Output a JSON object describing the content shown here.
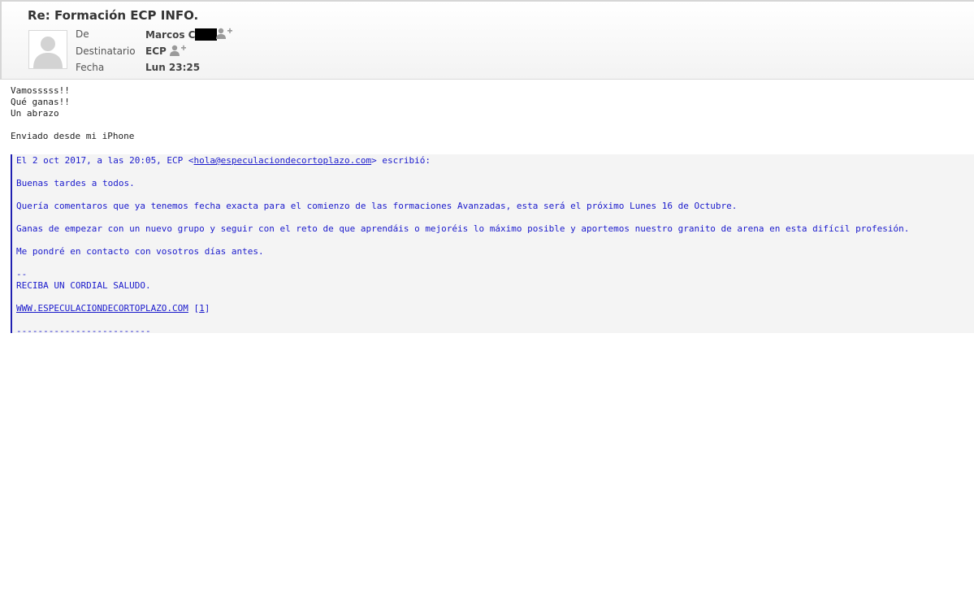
{
  "message": {
    "subject": "Re: Formación ECP INFO.",
    "from_label": "De",
    "from_value": "Marcos C",
    "to_label": "Destinatario",
    "to_value": "ECP",
    "date_label": "Fecha",
    "date_value": "Lun 23:25"
  },
  "body": {
    "line1": "Vamosssss!!",
    "line2": "Qué ganas!!",
    "line3": "Un abrazo",
    "signature": "Enviado desde mi iPhone"
  },
  "quote": {
    "intro_prefix": "El 2 oct 2017, a las 20:05, ECP <",
    "intro_email": "hola@especulaciondecortoplazo.com",
    "intro_suffix": "> escribió:",
    "greeting": "Buenas tardes a todos.",
    "para1": "Quería comentaros que ya tenemos fecha exacta para el comienzo de las formaciones Avanzadas, esta será el próximo Lunes 16 de Octubre.",
    "para2": "Ganas de empezar con un nuevo grupo y seguir con el reto de que aprendáis o mejoréis lo máximo posible y aportemos nuestro granito de arena en esta difícil profesión.",
    "para3": "Me pondré en contacto con vosotros días antes.",
    "sig_dash": "--",
    "sig_greeting": "RECIBA UN CORDIAL SALUDO.",
    "website": "WWW.ESPECULACIONDECORTOPLAZO.COM",
    "ref_open": "[",
    "ref_num": "1",
    "ref_close": "]",
    "separator": "-------------------------"
  },
  "colors": {
    "quote_text": "#1a1acc",
    "quote_border": "#2020b0",
    "quote_bg": "#f4f4f4"
  }
}
